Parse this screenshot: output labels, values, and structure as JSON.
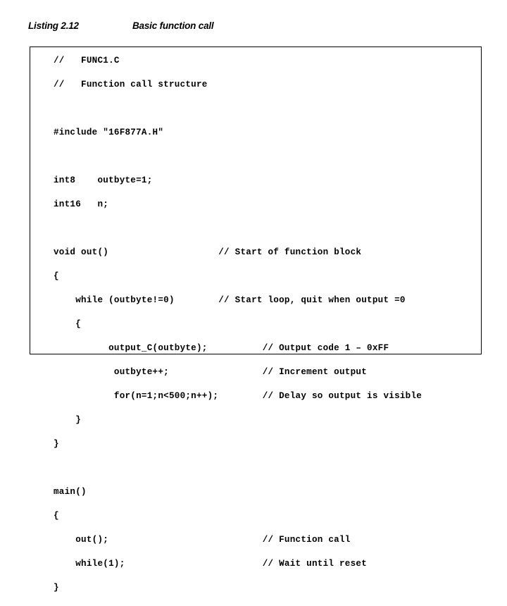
{
  "header": {
    "listing_label": "Listing 2.12",
    "listing_title": "Basic function call"
  },
  "code_box": {
    "border_color": "#000000",
    "background_color": "#ffffff",
    "text_color": "#000000",
    "lines": [
      {
        "code": "//   FUNC1.C",
        "comment": ""
      },
      {
        "code": "//   Function call structure",
        "comment": ""
      },
      {
        "code": "",
        "comment": ""
      },
      {
        "code": "#include \"16F877A.H\"",
        "comment": ""
      },
      {
        "code": "",
        "comment": ""
      },
      {
        "code": "int8    outbyte=1;",
        "comment": ""
      },
      {
        "code": "int16   n;",
        "comment": ""
      },
      {
        "code": "",
        "comment": ""
      },
      {
        "code": "void out()",
        "comment": "// Start of function block"
      },
      {
        "code": "{",
        "comment": ""
      },
      {
        "code": "    while (outbyte!=0)",
        "comment": "// Start loop, quit when output =0"
      },
      {
        "code": "    {",
        "comment": ""
      },
      {
        "code": "          output_C(outbyte);",
        "comment": "// Output code 1 – 0xFF"
      },
      {
        "code": "           outbyte++;",
        "comment": "// Increment output"
      },
      {
        "code": "           for(n=1;n<500;n++);",
        "comment": "// Delay so output is visible"
      },
      {
        "code": "    }",
        "comment": ""
      },
      {
        "code": "}",
        "comment": ""
      },
      {
        "code": "",
        "comment": ""
      },
      {
        "code": "main()",
        "comment": ""
      },
      {
        "code": "{",
        "comment": ""
      },
      {
        "code": "    out();",
        "comment": "// Function call"
      },
      {
        "code": "    while(1);",
        "comment": "// Wait until reset"
      },
      {
        "code": "}",
        "comment": ""
      }
    ],
    "comment_columns": {
      "default": 30,
      "indented": 38
    },
    "indented_comment_line_indexes": [
      12,
      13,
      14,
      20,
      21
    ]
  }
}
